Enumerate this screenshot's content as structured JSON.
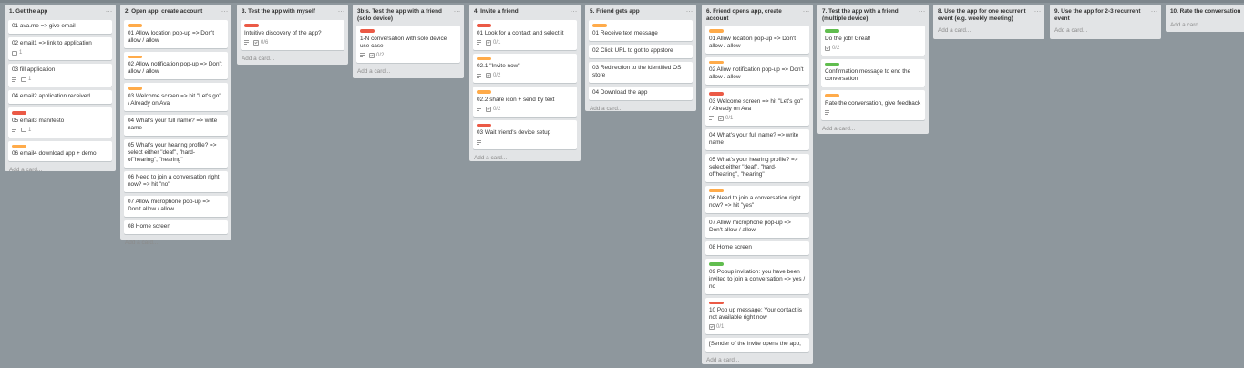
{
  "add_card_label": "Add a card...",
  "colors": {
    "orange": "#ffab4a",
    "red": "#eb5a46",
    "green": "#61bd4f"
  },
  "lists": [
    {
      "title": "1. Get the app",
      "cards": [
        {
          "text": "01 ava.me => give email"
        },
        {
          "text": "02 email1 => link to application",
          "badges": [
            {
              "type": "comments",
              "count": "1"
            }
          ]
        },
        {
          "text": "03 fill application",
          "badges": [
            {
              "type": "description"
            },
            {
              "type": "comments",
              "count": "1"
            }
          ]
        },
        {
          "text": "04 email2 application received"
        },
        {
          "text": "05 email3 manifesto",
          "label": "red",
          "badges": [
            {
              "type": "description"
            },
            {
              "type": "comments",
              "count": "1"
            }
          ]
        },
        {
          "text": "06 email4 download app + demo",
          "label": "orange"
        }
      ]
    },
    {
      "title": "2. Open app, create account",
      "cards": [
        {
          "text": "01 Allow location pop-up => Don't allow / allow",
          "label": "orange"
        },
        {
          "text": "02 Allow notification pop-up => Don't allow / allow",
          "label": "orange"
        },
        {
          "text": "03 Welcome screen => hit \"Let's go\" / Already on Ava",
          "label": "orange"
        },
        {
          "text": "04 What's your full name? => write name"
        },
        {
          "text": "05 What's your hearing profile? => select either \"deaf\", \"hard-of\"hearing\", \"hearing\""
        },
        {
          "text": "06 Need to join a conversation right now? => hit \"no\""
        },
        {
          "text": "07 Allow microphone pop-up => Don't allow / allow"
        },
        {
          "text": "08 Home screen"
        }
      ]
    },
    {
      "title": "3. Test the app with myself",
      "cards": [
        {
          "text": "Intuitive discovery of the app?",
          "label": "red",
          "badges": [
            {
              "type": "description"
            },
            {
              "type": "checklist",
              "count": "0/6"
            }
          ]
        }
      ]
    },
    {
      "title": "3bis. Test the app with a friend (solo device)",
      "cards": [
        {
          "text": "1-N conversation with solo device use case",
          "label": "red",
          "badges": [
            {
              "type": "description"
            },
            {
              "type": "checklist",
              "count": "0/2"
            }
          ]
        }
      ]
    },
    {
      "title": "4. Invite a friend",
      "cards": [
        {
          "text": "01 Look for a contact and select it",
          "label": "red",
          "badges": [
            {
              "type": "description"
            },
            {
              "type": "checklist",
              "count": "0/1"
            }
          ]
        },
        {
          "text": "02.1 \"Invite now\"",
          "label": "orange",
          "badges": [
            {
              "type": "description"
            },
            {
              "type": "checklist",
              "count": "0/2"
            }
          ]
        },
        {
          "text": "02.2 share icon + send by text",
          "label": "orange",
          "badges": [
            {
              "type": "description"
            },
            {
              "type": "checklist",
              "count": "0/2"
            }
          ]
        },
        {
          "text": "03 Wait friend's device setup",
          "label": "red",
          "badges": [
            {
              "type": "description"
            }
          ]
        }
      ]
    },
    {
      "title": "5. Friend gets app",
      "cards": [
        {
          "text": "01 Receive text message",
          "label": "orange"
        },
        {
          "text": "02 Click URL to got to appstore"
        },
        {
          "text": "03 Redirection to the identified OS store"
        },
        {
          "text": "04 Download the app"
        }
      ]
    },
    {
      "title": "6. Friend opens app, create account",
      "cards": [
        {
          "text": "01 Allow location pop-up => Don't allow / allow",
          "label": "orange"
        },
        {
          "text": "02 Allow notification pop-up => Don't allow / allow",
          "label": "orange"
        },
        {
          "text": "03 Welcome screen => hit \"Let's go\" / Already on Ava",
          "label": "red",
          "badges": [
            {
              "type": "description"
            },
            {
              "type": "checklist",
              "count": "0/1"
            }
          ]
        },
        {
          "text": "04 What's your full name? => write name"
        },
        {
          "text": "05 What's your hearing profile? => select either \"deaf\", \"hard-of\"hearing\", \"hearing\""
        },
        {
          "text": "06 Need to join a conversation right now? => hit \"yes\"",
          "label": "orange"
        },
        {
          "text": "07 Allow microphone pop-up => Don't allow / allow"
        },
        {
          "text": "08 Home screen"
        },
        {
          "text": "09 Popup invitation: you have been invited to join a conversation => yes / no",
          "label": "green"
        },
        {
          "text": "10 Pop up message: Your contact is not available right now",
          "label": "red",
          "badges": [
            {
              "type": "checklist",
              "count": "0/1"
            }
          ]
        },
        {
          "text": "[Sender of the invite opens the app,"
        }
      ]
    },
    {
      "title": "7. Test the app with a friend (multiple device)",
      "cards": [
        {
          "text": "Do the job! Great!",
          "label": "green",
          "badges": [
            {
              "type": "checklist",
              "count": "0/2"
            }
          ]
        },
        {
          "text": "Confirmation message to end the conversation",
          "label": "green"
        },
        {
          "text": "Rate the conversation, give feedback",
          "label": "orange",
          "badges": [
            {
              "type": "description"
            }
          ]
        }
      ]
    },
    {
      "title": "8. Use the app for one recurrent event (e.g. weekly meeting)",
      "cards": []
    },
    {
      "title": "9. Use the app for 2-3 recurrent event",
      "cards": []
    },
    {
      "title": "10. Rate the conversation",
      "cards": []
    }
  ]
}
